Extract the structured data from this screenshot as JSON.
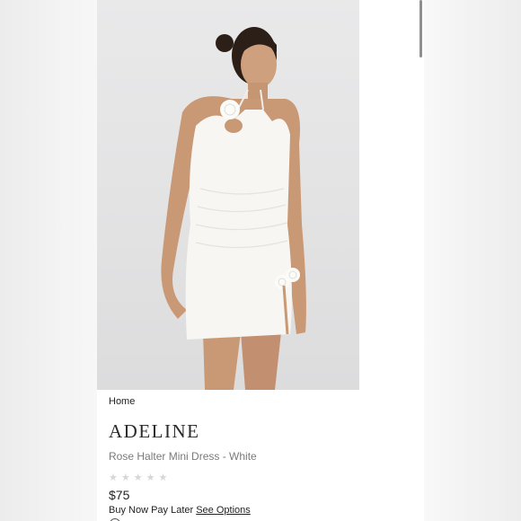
{
  "breadcrumb": {
    "home_label": "Home"
  },
  "product": {
    "brand": "ADELINE",
    "subtitle": "Rose Halter Mini Dress - White",
    "rating": {
      "max": 5,
      "filled": 0,
      "star_char": "★"
    },
    "price": "$75",
    "bnpl_text": "Buy Now Pay Later",
    "bnpl_link": "See Options"
  },
  "colors": {
    "photo_bg": "#e4e4e5",
    "dress": "#f7f6f2",
    "skin": "#c99874",
    "hair": "#2b1f18"
  },
  "icons": {
    "info": "info-circle-icon",
    "star": "star-icon"
  }
}
